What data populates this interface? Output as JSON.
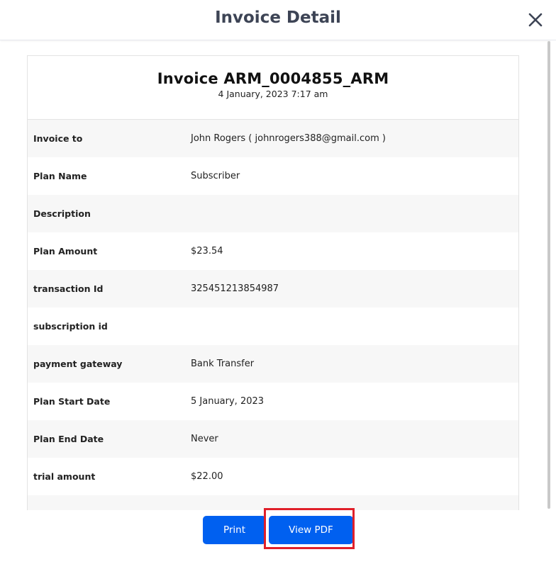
{
  "modal": {
    "title": "Invoice Detail"
  },
  "invoice": {
    "title": "Invoice ARM_0004855_ARM",
    "date": "4 January, 2023 7:17 am",
    "rows": [
      {
        "label": "Invoice to",
        "value": "John Rogers ( johnrogers388@gmail.com )"
      },
      {
        "label": "Plan Name",
        "value": "Subscriber"
      },
      {
        "label": "Description",
        "value": ""
      },
      {
        "label": "Plan Amount",
        "value": "$23.54"
      },
      {
        "label": "transaction Id",
        "value": "325451213854987"
      },
      {
        "label": "subscription id",
        "value": ""
      },
      {
        "label": "payment gateway",
        "value": "Bank Transfer"
      },
      {
        "label": "Plan Start Date",
        "value": "5 January, 2023"
      },
      {
        "label": "Plan End Date",
        "value": "Never"
      },
      {
        "label": "trial amount",
        "value": "$22.00"
      },
      {
        "label": "",
        "value": ""
      }
    ]
  },
  "footer": {
    "print_label": "Print",
    "view_pdf_label": "View PDF"
  },
  "colors": {
    "primary_button": "#0060f0",
    "highlight": "#e0202a",
    "title_text": "#3d4455",
    "row_shade": "#f7f7f7"
  },
  "icons": {
    "close": "close-icon"
  }
}
